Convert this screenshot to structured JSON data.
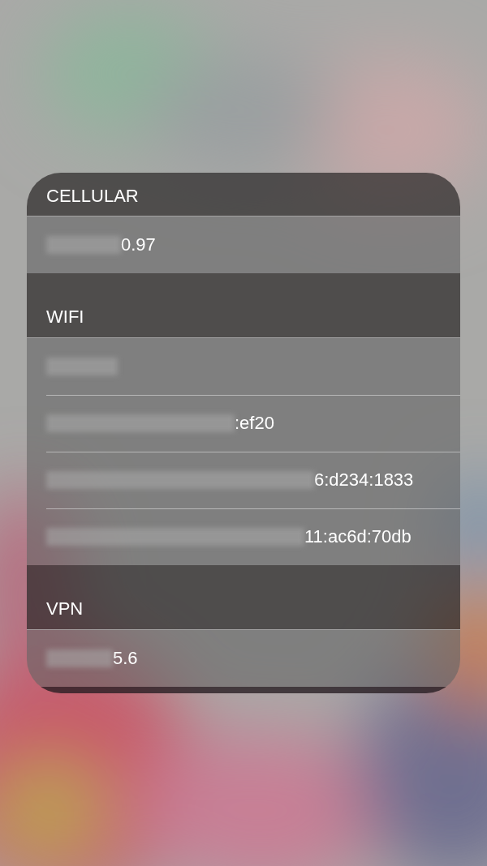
{
  "sections": [
    {
      "title": "CELLULAR",
      "rows": [
        {
          "value": "0.97",
          "redacted": true
        }
      ]
    },
    {
      "title": "WIFI",
      "rows": [
        {
          "redacted": true
        },
        {
          "value": ":ef20",
          "redacted": true
        },
        {
          "value": "6:d234:1833",
          "redacted": true
        },
        {
          "value": "11:ac6d:70db",
          "redacted": true
        }
      ]
    },
    {
      "title": "VPN",
      "rows": [
        {
          "value": "5.6",
          "redacted": true
        }
      ]
    }
  ]
}
